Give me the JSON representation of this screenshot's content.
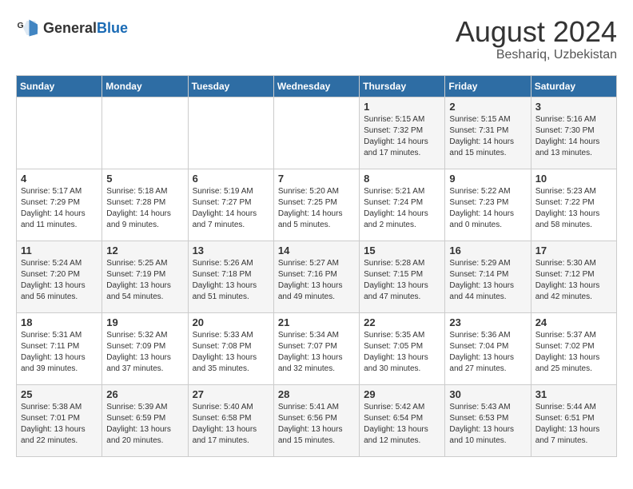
{
  "logo": {
    "general": "General",
    "blue": "Blue"
  },
  "title": "August 2024",
  "location": "Beshariq, Uzbekistan",
  "days_of_week": [
    "Sunday",
    "Monday",
    "Tuesday",
    "Wednesday",
    "Thursday",
    "Friday",
    "Saturday"
  ],
  "weeks": [
    [
      {
        "day": "",
        "info": ""
      },
      {
        "day": "",
        "info": ""
      },
      {
        "day": "",
        "info": ""
      },
      {
        "day": "",
        "info": ""
      },
      {
        "day": "1",
        "info": "Sunrise: 5:15 AM\nSunset: 7:32 PM\nDaylight: 14 hours\nand 17 minutes."
      },
      {
        "day": "2",
        "info": "Sunrise: 5:15 AM\nSunset: 7:31 PM\nDaylight: 14 hours\nand 15 minutes."
      },
      {
        "day": "3",
        "info": "Sunrise: 5:16 AM\nSunset: 7:30 PM\nDaylight: 14 hours\nand 13 minutes."
      }
    ],
    [
      {
        "day": "4",
        "info": "Sunrise: 5:17 AM\nSunset: 7:29 PM\nDaylight: 14 hours\nand 11 minutes."
      },
      {
        "day": "5",
        "info": "Sunrise: 5:18 AM\nSunset: 7:28 PM\nDaylight: 14 hours\nand 9 minutes."
      },
      {
        "day": "6",
        "info": "Sunrise: 5:19 AM\nSunset: 7:27 PM\nDaylight: 14 hours\nand 7 minutes."
      },
      {
        "day": "7",
        "info": "Sunrise: 5:20 AM\nSunset: 7:25 PM\nDaylight: 14 hours\nand 5 minutes."
      },
      {
        "day": "8",
        "info": "Sunrise: 5:21 AM\nSunset: 7:24 PM\nDaylight: 14 hours\nand 2 minutes."
      },
      {
        "day": "9",
        "info": "Sunrise: 5:22 AM\nSunset: 7:23 PM\nDaylight: 14 hours\nand 0 minutes."
      },
      {
        "day": "10",
        "info": "Sunrise: 5:23 AM\nSunset: 7:22 PM\nDaylight: 13 hours\nand 58 minutes."
      }
    ],
    [
      {
        "day": "11",
        "info": "Sunrise: 5:24 AM\nSunset: 7:20 PM\nDaylight: 13 hours\nand 56 minutes."
      },
      {
        "day": "12",
        "info": "Sunrise: 5:25 AM\nSunset: 7:19 PM\nDaylight: 13 hours\nand 54 minutes."
      },
      {
        "day": "13",
        "info": "Sunrise: 5:26 AM\nSunset: 7:18 PM\nDaylight: 13 hours\nand 51 minutes."
      },
      {
        "day": "14",
        "info": "Sunrise: 5:27 AM\nSunset: 7:16 PM\nDaylight: 13 hours\nand 49 minutes."
      },
      {
        "day": "15",
        "info": "Sunrise: 5:28 AM\nSunset: 7:15 PM\nDaylight: 13 hours\nand 47 minutes."
      },
      {
        "day": "16",
        "info": "Sunrise: 5:29 AM\nSunset: 7:14 PM\nDaylight: 13 hours\nand 44 minutes."
      },
      {
        "day": "17",
        "info": "Sunrise: 5:30 AM\nSunset: 7:12 PM\nDaylight: 13 hours\nand 42 minutes."
      }
    ],
    [
      {
        "day": "18",
        "info": "Sunrise: 5:31 AM\nSunset: 7:11 PM\nDaylight: 13 hours\nand 39 minutes."
      },
      {
        "day": "19",
        "info": "Sunrise: 5:32 AM\nSunset: 7:09 PM\nDaylight: 13 hours\nand 37 minutes."
      },
      {
        "day": "20",
        "info": "Sunrise: 5:33 AM\nSunset: 7:08 PM\nDaylight: 13 hours\nand 35 minutes."
      },
      {
        "day": "21",
        "info": "Sunrise: 5:34 AM\nSunset: 7:07 PM\nDaylight: 13 hours\nand 32 minutes."
      },
      {
        "day": "22",
        "info": "Sunrise: 5:35 AM\nSunset: 7:05 PM\nDaylight: 13 hours\nand 30 minutes."
      },
      {
        "day": "23",
        "info": "Sunrise: 5:36 AM\nSunset: 7:04 PM\nDaylight: 13 hours\nand 27 minutes."
      },
      {
        "day": "24",
        "info": "Sunrise: 5:37 AM\nSunset: 7:02 PM\nDaylight: 13 hours\nand 25 minutes."
      }
    ],
    [
      {
        "day": "25",
        "info": "Sunrise: 5:38 AM\nSunset: 7:01 PM\nDaylight: 13 hours\nand 22 minutes."
      },
      {
        "day": "26",
        "info": "Sunrise: 5:39 AM\nSunset: 6:59 PM\nDaylight: 13 hours\nand 20 minutes."
      },
      {
        "day": "27",
        "info": "Sunrise: 5:40 AM\nSunset: 6:58 PM\nDaylight: 13 hours\nand 17 minutes."
      },
      {
        "day": "28",
        "info": "Sunrise: 5:41 AM\nSunset: 6:56 PM\nDaylight: 13 hours\nand 15 minutes."
      },
      {
        "day": "29",
        "info": "Sunrise: 5:42 AM\nSunset: 6:54 PM\nDaylight: 13 hours\nand 12 minutes."
      },
      {
        "day": "30",
        "info": "Sunrise: 5:43 AM\nSunset: 6:53 PM\nDaylight: 13 hours\nand 10 minutes."
      },
      {
        "day": "31",
        "info": "Sunrise: 5:44 AM\nSunset: 6:51 PM\nDaylight: 13 hours\nand 7 minutes."
      }
    ]
  ]
}
